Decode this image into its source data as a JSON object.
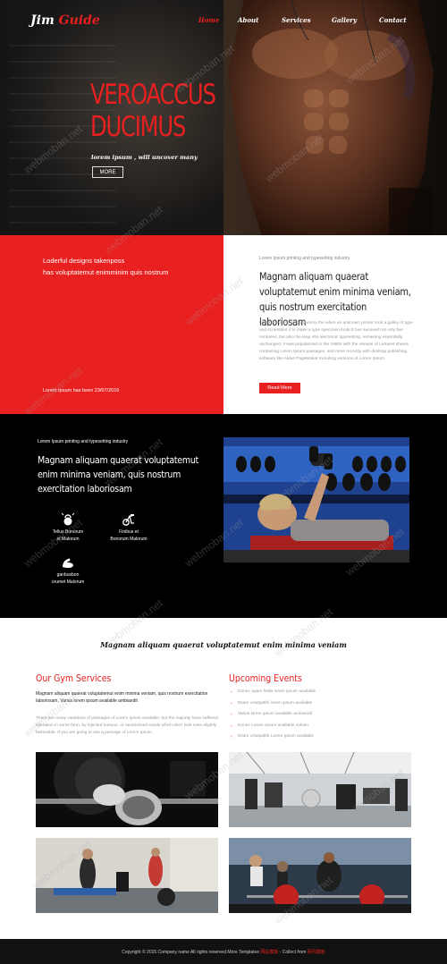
{
  "brand": {
    "logo_part1": "Jim ",
    "logo_part2": "Guide"
  },
  "nav": {
    "items": [
      "Home",
      "About",
      "Services",
      "Gallery",
      "Contact"
    ],
    "active": "Home"
  },
  "hero": {
    "title_line1": "VEROACCUS",
    "title_line2": "DUCIMUS",
    "subtitle": "lorem ipsum , will uncover many",
    "button": "MORE"
  },
  "about": {
    "red_line1": "Loderful designs takenposs",
    "red_line2": "has voluptatemut enimminim quis nostrum",
    "red_date": "Lorem Ipsum has been 23/07/2016",
    "kicker": "Lorem Ipsum printing and typesetting industry",
    "heading": "Magnam aliquam quaerat voluptatemut enim minima veniam, quis nostrum exercitation laboriosam",
    "body": "Lorem Ipsum is simply dummy the when an unknown printer took a galley of type and scrambled it to make a type specimen book.It has survived not only five centuries, but also the leap into electronic typesetting, remaining essentially unchanged. It was popularised in the 1960s with the release of Letraset sheets containing Lorem Ipsum passages, and more recently with desktop publishing software like Aldus PageMaker including versions of Lorem Ipsum.",
    "button": "Read More"
  },
  "features": {
    "kicker": "Lorem Ipsum printing and typesetting industry",
    "heading": "Magnam aliquam quaerat voluptatemut enim minima veniam, quis nostrum exercitation laboriosam",
    "items": [
      {
        "line1": "Tellus Bonorum",
        "line2": "et Malorum",
        "icon": "kettlebell-icon"
      },
      {
        "line1": "Finibus et",
        "line2": "Bonorum Malorum",
        "icon": "exercise-bike-icon"
      },
      {
        "line1": "ganbusbon",
        "line2": "orumet Malorum",
        "icon": "flexed-arm-icon"
      }
    ]
  },
  "tagline": "Magnam aliquam quaerat voluptatemut enim minima veniam",
  "services": {
    "title": "Our Gym Services",
    "lead": "Magnam aliquam quaerat voluptatemut enim minima veniam, quis nostrum exercitation laboriosam, Varius lorem ipsum available ambiandit",
    "body": "There are many variations of passages of Lorem Ipsum available, but the majority have suffered alteration in some form, by injected humour, or randomised words which don't look even slightly believable. If you are going to use a passage of Lorem Ipsum"
  },
  "events": {
    "title": "Upcoming Events",
    "items": [
      "Donec quam feslis lorem ipsum available",
      "Etiam volutpatlrk lorem ipsum available",
      "Varius lorem ipsum available ambiandit",
      "Donec Lorem Ipsum available volutm",
      "Etiam volutpatlrk Lorem Ipsum available"
    ]
  },
  "footer": {
    "prefix": "Copyright © 2015 Company name All rights reserved.More Templates ",
    "link1": "网站模板",
    "middle": " - Collect from ",
    "link2": "网页模板"
  },
  "watermark": "webmoban.net",
  "colors": {
    "accent": "#e8201f",
    "dark": "#000000",
    "footer": "#111111"
  }
}
